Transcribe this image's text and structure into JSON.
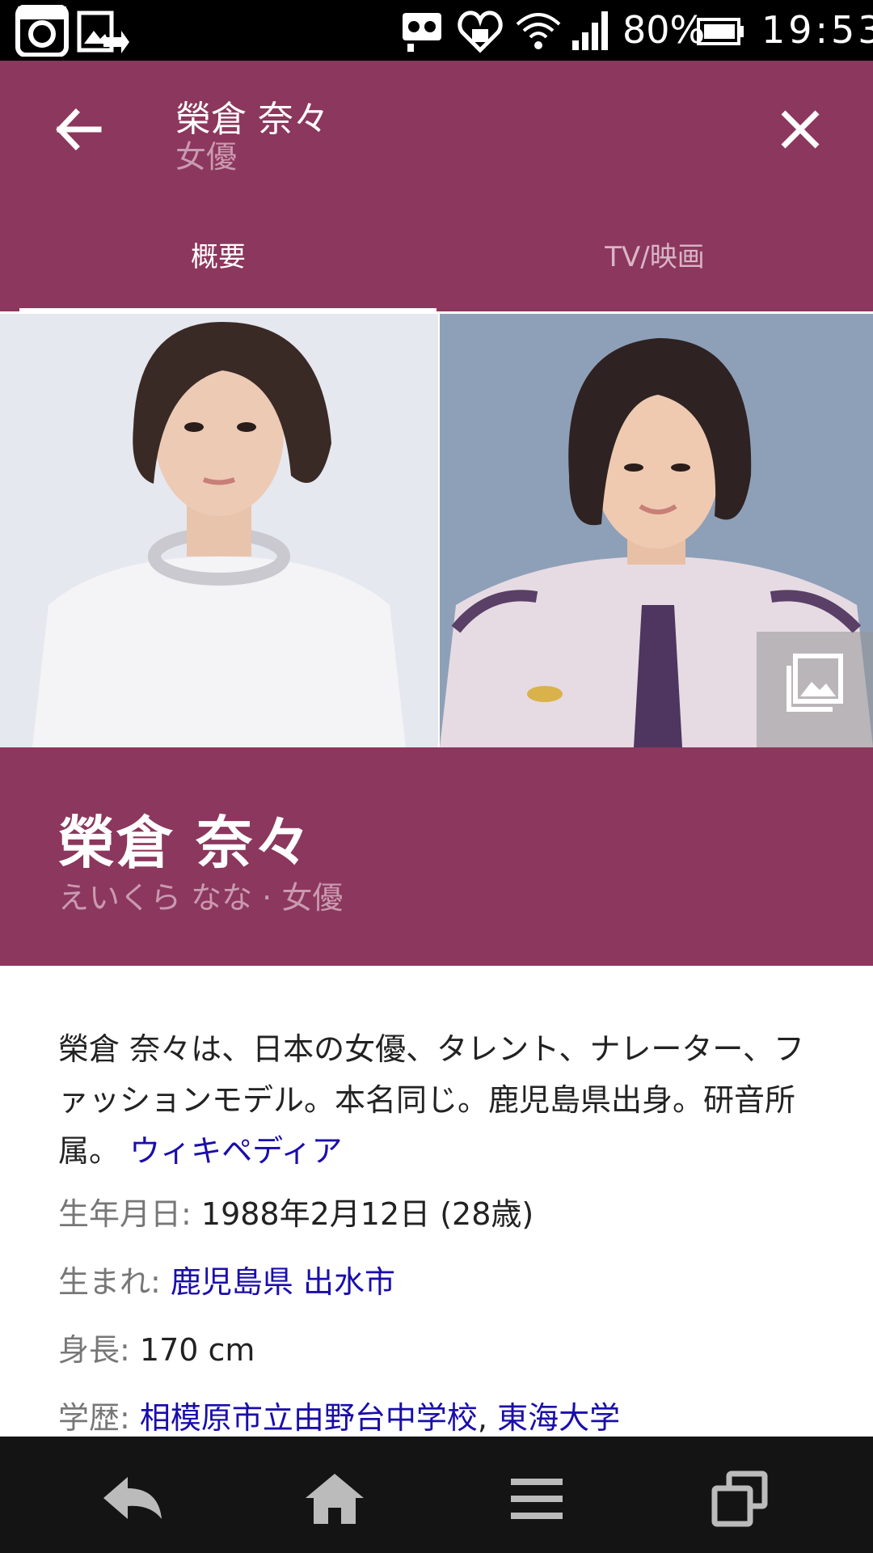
{
  "status_bar": {
    "battery_percent": "80%",
    "time": "19:53",
    "icons": [
      "instagram-icon",
      "gallery-share-icon",
      "notification-icon",
      "heart-monitor-icon",
      "wifi-icon",
      "signal-icon",
      "battery-icon"
    ]
  },
  "header": {
    "title": "榮倉 奈々",
    "subtitle": "女優"
  },
  "tabs": [
    {
      "label": "概要",
      "selected": true
    },
    {
      "label": "TV/映画",
      "selected": false
    }
  ],
  "hero": {
    "name": "榮倉 奈々",
    "reading": "えいくら なな · 女優"
  },
  "description": {
    "text": "榮倉 奈々は、日本の女優、タレント、ナレーター、ファッションモデル。本名同じ。鹿児島県出身。研音所属。",
    "source_link": "ウィキペディア"
  },
  "facts": {
    "birth": {
      "label": "生年月日:",
      "value": "1988年2月12日 (28歳)"
    },
    "born": {
      "label": "生まれ:",
      "link1": "鹿児島県",
      "link2": "出水市"
    },
    "height": {
      "label": "身長:",
      "value": "170 cm"
    },
    "education": {
      "label": "学歴:",
      "link1": "相模原市立由野台中学校",
      "sep": ",",
      "link2": "東海大学"
    }
  },
  "colors": {
    "brand": "#8c375d",
    "link": "#1a0dab",
    "nav_bar": "#141414"
  }
}
